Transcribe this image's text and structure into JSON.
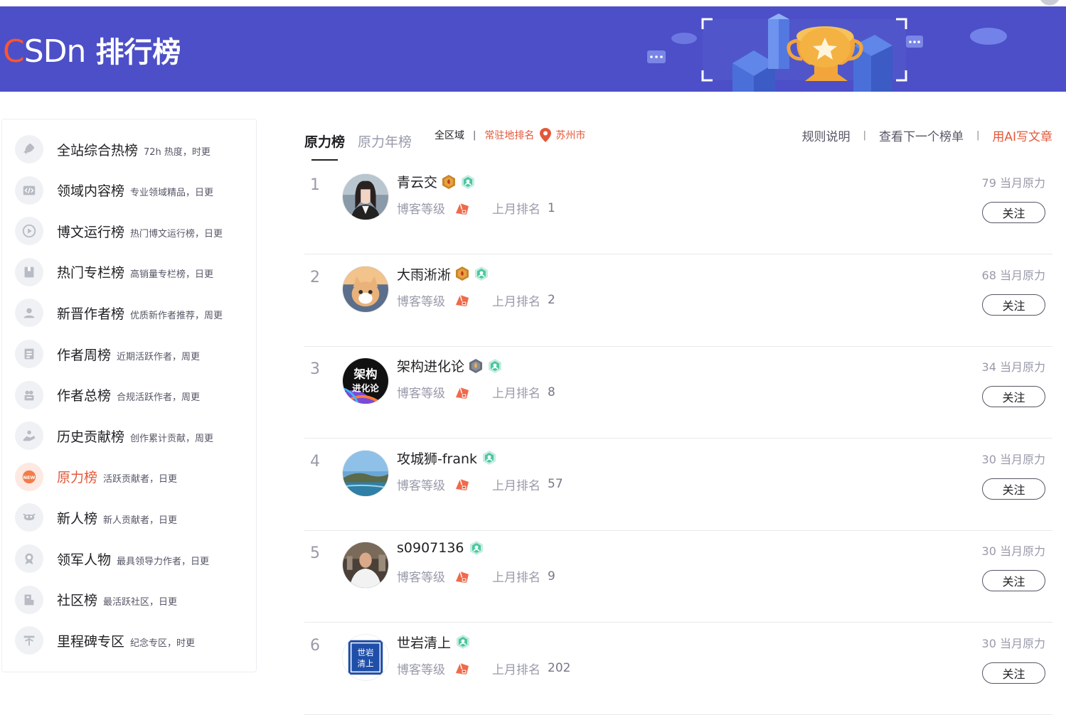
{
  "brand": {
    "logo_c": "C",
    "logo_rest": "SDn",
    "title": "排行榜"
  },
  "colors": {
    "banner": "#4c4fc7",
    "accent": "#e3583a",
    "brand_red": "#fc5531"
  },
  "sidebar": {
    "items": [
      {
        "name": "全站综合热榜",
        "desc": "72h 热度，时更",
        "icon": "rocket-icon"
      },
      {
        "name": "领域内容榜",
        "desc": "专业领域精品，日更",
        "icon": "code-icon"
      },
      {
        "name": "博文运行榜",
        "desc": "热门博文运行榜，日更",
        "icon": "play-icon"
      },
      {
        "name": "热门专栏榜",
        "desc": "高销量专栏榜，日更",
        "icon": "book-icon"
      },
      {
        "name": "新晋作者榜",
        "desc": "优质新作者推荐，周更",
        "icon": "user-icon"
      },
      {
        "name": "作者周榜",
        "desc": "近期活跃作者，周更",
        "icon": "calendar-icon"
      },
      {
        "name": "作者总榜",
        "desc": "合规活跃作者，周更",
        "icon": "group-icon"
      },
      {
        "name": "历史贡献榜",
        "desc": "创作累计贡献，周更",
        "icon": "hand-icon"
      },
      {
        "name": "原力榜",
        "desc": "活跃贡献者，日更",
        "icon": "new-badge-icon",
        "active": true
      },
      {
        "name": "新人榜",
        "desc": "新人贡献者，日更",
        "icon": "newbie-icon"
      },
      {
        "name": "领军人物",
        "desc": "最具领导力作者，日更",
        "icon": "medal-icon"
      },
      {
        "name": "社区榜",
        "desc": "最活跃社区，日更",
        "icon": "community-icon"
      },
      {
        "name": "里程碑专区",
        "desc": "纪念专区，时更",
        "icon": "milestone-icon"
      }
    ]
  },
  "tabs": [
    {
      "label": "原力榜",
      "active": true
    },
    {
      "label": "原力年榜",
      "active": false
    }
  ],
  "filters": {
    "all": "全区域",
    "region": "常驻地排名",
    "city": "苏州市"
  },
  "header_links": {
    "rules": "规则说明",
    "next": "查看下一个榜单",
    "ai": "用AI写文章"
  },
  "labels": {
    "blog_level": "博客等级",
    "last_month": "上月排名",
    "power_suffix": "当月原力",
    "follow": "关注"
  },
  "rankings": [
    {
      "rank": "1",
      "name": "青云交",
      "last_rank": "1",
      "power": "79",
      "badge": "gold"
    },
    {
      "rank": "2",
      "name": "大雨淅淅",
      "last_rank": "2",
      "power": "68",
      "badge": "gold"
    },
    {
      "rank": "3",
      "name": "架构进化论",
      "last_rank": "8",
      "power": "34",
      "badge": "silver"
    },
    {
      "rank": "4",
      "name": "攻城狮-frank",
      "last_rank": "57",
      "power": "30",
      "badge": "none"
    },
    {
      "rank": "5",
      "name": "s0907136",
      "last_rank": "9",
      "power": "30",
      "badge": "none"
    },
    {
      "rank": "6",
      "name": "世岩清上",
      "last_rank": "202",
      "power": "30",
      "badge": "none"
    }
  ],
  "avatar3_text": {
    "line1": "架构",
    "line2": "进化论"
  },
  "avatar6_text": {
    "line1": "世岩",
    "line2": "清上"
  }
}
